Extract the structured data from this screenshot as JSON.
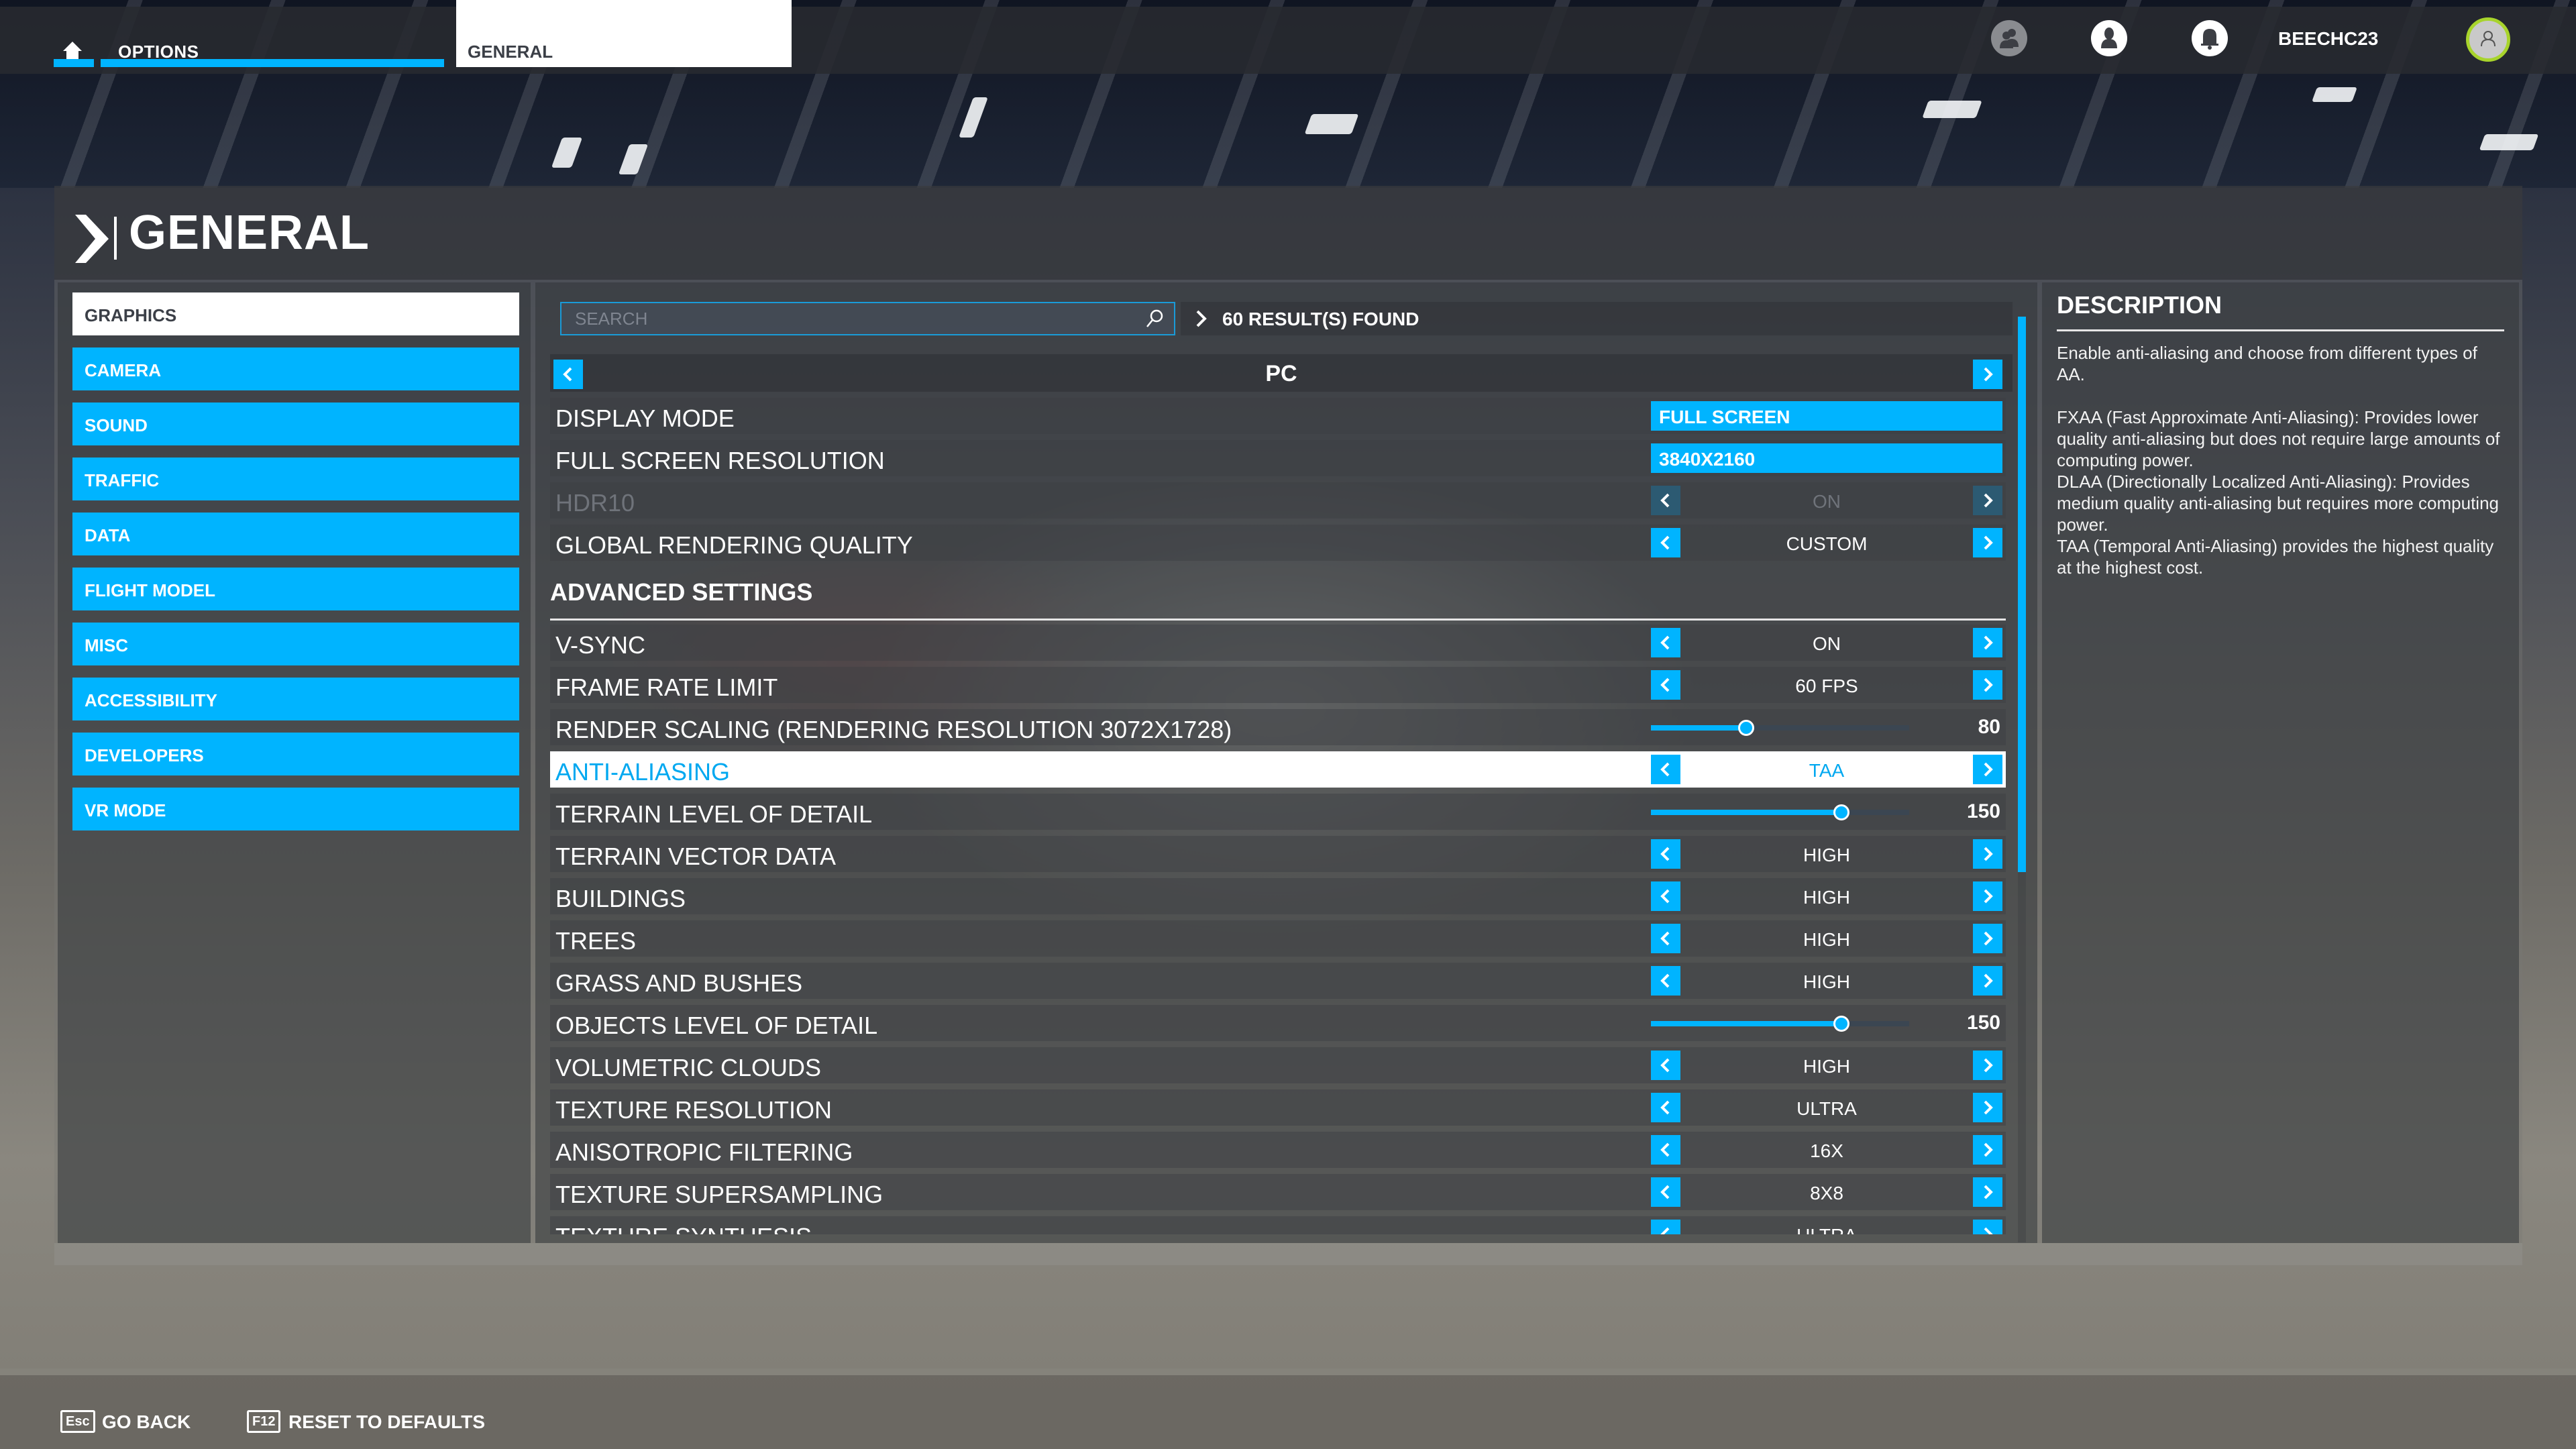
{
  "topbar": {
    "home_icon": "home-icon",
    "breadcrumb_options": "OPTIONS",
    "breadcrumb_general": "GENERAL",
    "icons": [
      "friends-icon",
      "profile-icon",
      "notifications-bell-icon"
    ],
    "username": "BEECHC23",
    "avatar_icon": "user-avatar-icon"
  },
  "page": {
    "title": "GENERAL"
  },
  "sidebar": {
    "items": [
      {
        "label": "GRAPHICS",
        "active": true
      },
      {
        "label": "CAMERA",
        "active": false
      },
      {
        "label": "SOUND",
        "active": false
      },
      {
        "label": "TRAFFIC",
        "active": false
      },
      {
        "label": "DATA",
        "active": false
      },
      {
        "label": "FLIGHT MODEL",
        "active": false
      },
      {
        "label": "MISC",
        "active": false
      },
      {
        "label": "ACCESSIBILITY",
        "active": false
      },
      {
        "label": "DEVELOPERS",
        "active": false
      },
      {
        "label": "VR MODE",
        "active": false
      }
    ]
  },
  "search": {
    "placeholder": "SEARCH",
    "value": "",
    "results": "60 RESULT(S) FOUND"
  },
  "platform": {
    "label": "PC"
  },
  "settings_top": [
    {
      "label": "DISPLAY MODE",
      "type": "dropdown",
      "value": "FULL SCREEN"
    },
    {
      "label": "FULL SCREEN RESOLUTION",
      "type": "dropdown",
      "value": "3840X2160"
    },
    {
      "label": "HDR10",
      "type": "select",
      "value": "ON",
      "disabled": true
    },
    {
      "label": "GLOBAL RENDERING QUALITY",
      "type": "select",
      "value": "CUSTOM"
    }
  ],
  "advanced": {
    "heading": "ADVANCED SETTINGS",
    "settings": [
      {
        "label": "V-SYNC",
        "type": "select",
        "value": "ON"
      },
      {
        "label": "FRAME RATE LIMIT",
        "type": "select",
        "value": "60 FPS"
      },
      {
        "label": "RENDER SCALING (RENDERING RESOLUTION 3072X1728)",
        "type": "slider",
        "value": 80,
        "min": 10,
        "max": 200
      },
      {
        "label": "ANTI-ALIASING",
        "type": "select",
        "value": "TAA",
        "selected": true
      },
      {
        "label": "TERRAIN LEVEL OF DETAIL",
        "type": "slider",
        "value": 150,
        "min": 10,
        "max": 200
      },
      {
        "label": "TERRAIN VECTOR DATA",
        "type": "select",
        "value": "HIGH"
      },
      {
        "label": "BUILDINGS",
        "type": "select",
        "value": "HIGH"
      },
      {
        "label": "TREES",
        "type": "select",
        "value": "HIGH"
      },
      {
        "label": "GRASS AND BUSHES",
        "type": "select",
        "value": "HIGH"
      },
      {
        "label": "OBJECTS LEVEL OF DETAIL",
        "type": "slider",
        "value": 150,
        "min": 10,
        "max": 200
      },
      {
        "label": "VOLUMETRIC CLOUDS",
        "type": "select",
        "value": "HIGH"
      },
      {
        "label": "TEXTURE RESOLUTION",
        "type": "select",
        "value": "ULTRA"
      },
      {
        "label": "ANISOTROPIC FILTERING",
        "type": "select",
        "value": "16X"
      },
      {
        "label": "TEXTURE SUPERSAMPLING",
        "type": "select",
        "value": "8X8"
      },
      {
        "label": "TEXTURE SYNTHESIS",
        "type": "select",
        "value": "ULTRA"
      }
    ]
  },
  "scrollbar": {
    "position_fraction": 0.0,
    "visible_fraction": 0.6
  },
  "description": {
    "title": "DESCRIPTION",
    "body": "Enable anti-aliasing and choose from different types of AA.\n\nFXAA (Fast Approximate Anti-Aliasing): Provides lower quality anti-aliasing but does not require large amounts of computing power.\nDLAA (Directionally Localized Anti-Aliasing): Provides medium quality anti-aliasing but requires more computing power.\nTAA (Temporal Anti-Aliasing) provides the highest quality at the highest cost."
  },
  "footer": {
    "go_back": {
      "key": "Esc",
      "label": "GO BACK"
    },
    "reset": {
      "key": "F12",
      "label": "RESET TO DEFAULTS"
    }
  },
  "colors": {
    "accent": "#00b4ff",
    "avatar_ring": "#a8d42c",
    "disabled_arrow": "#2c5a72"
  }
}
